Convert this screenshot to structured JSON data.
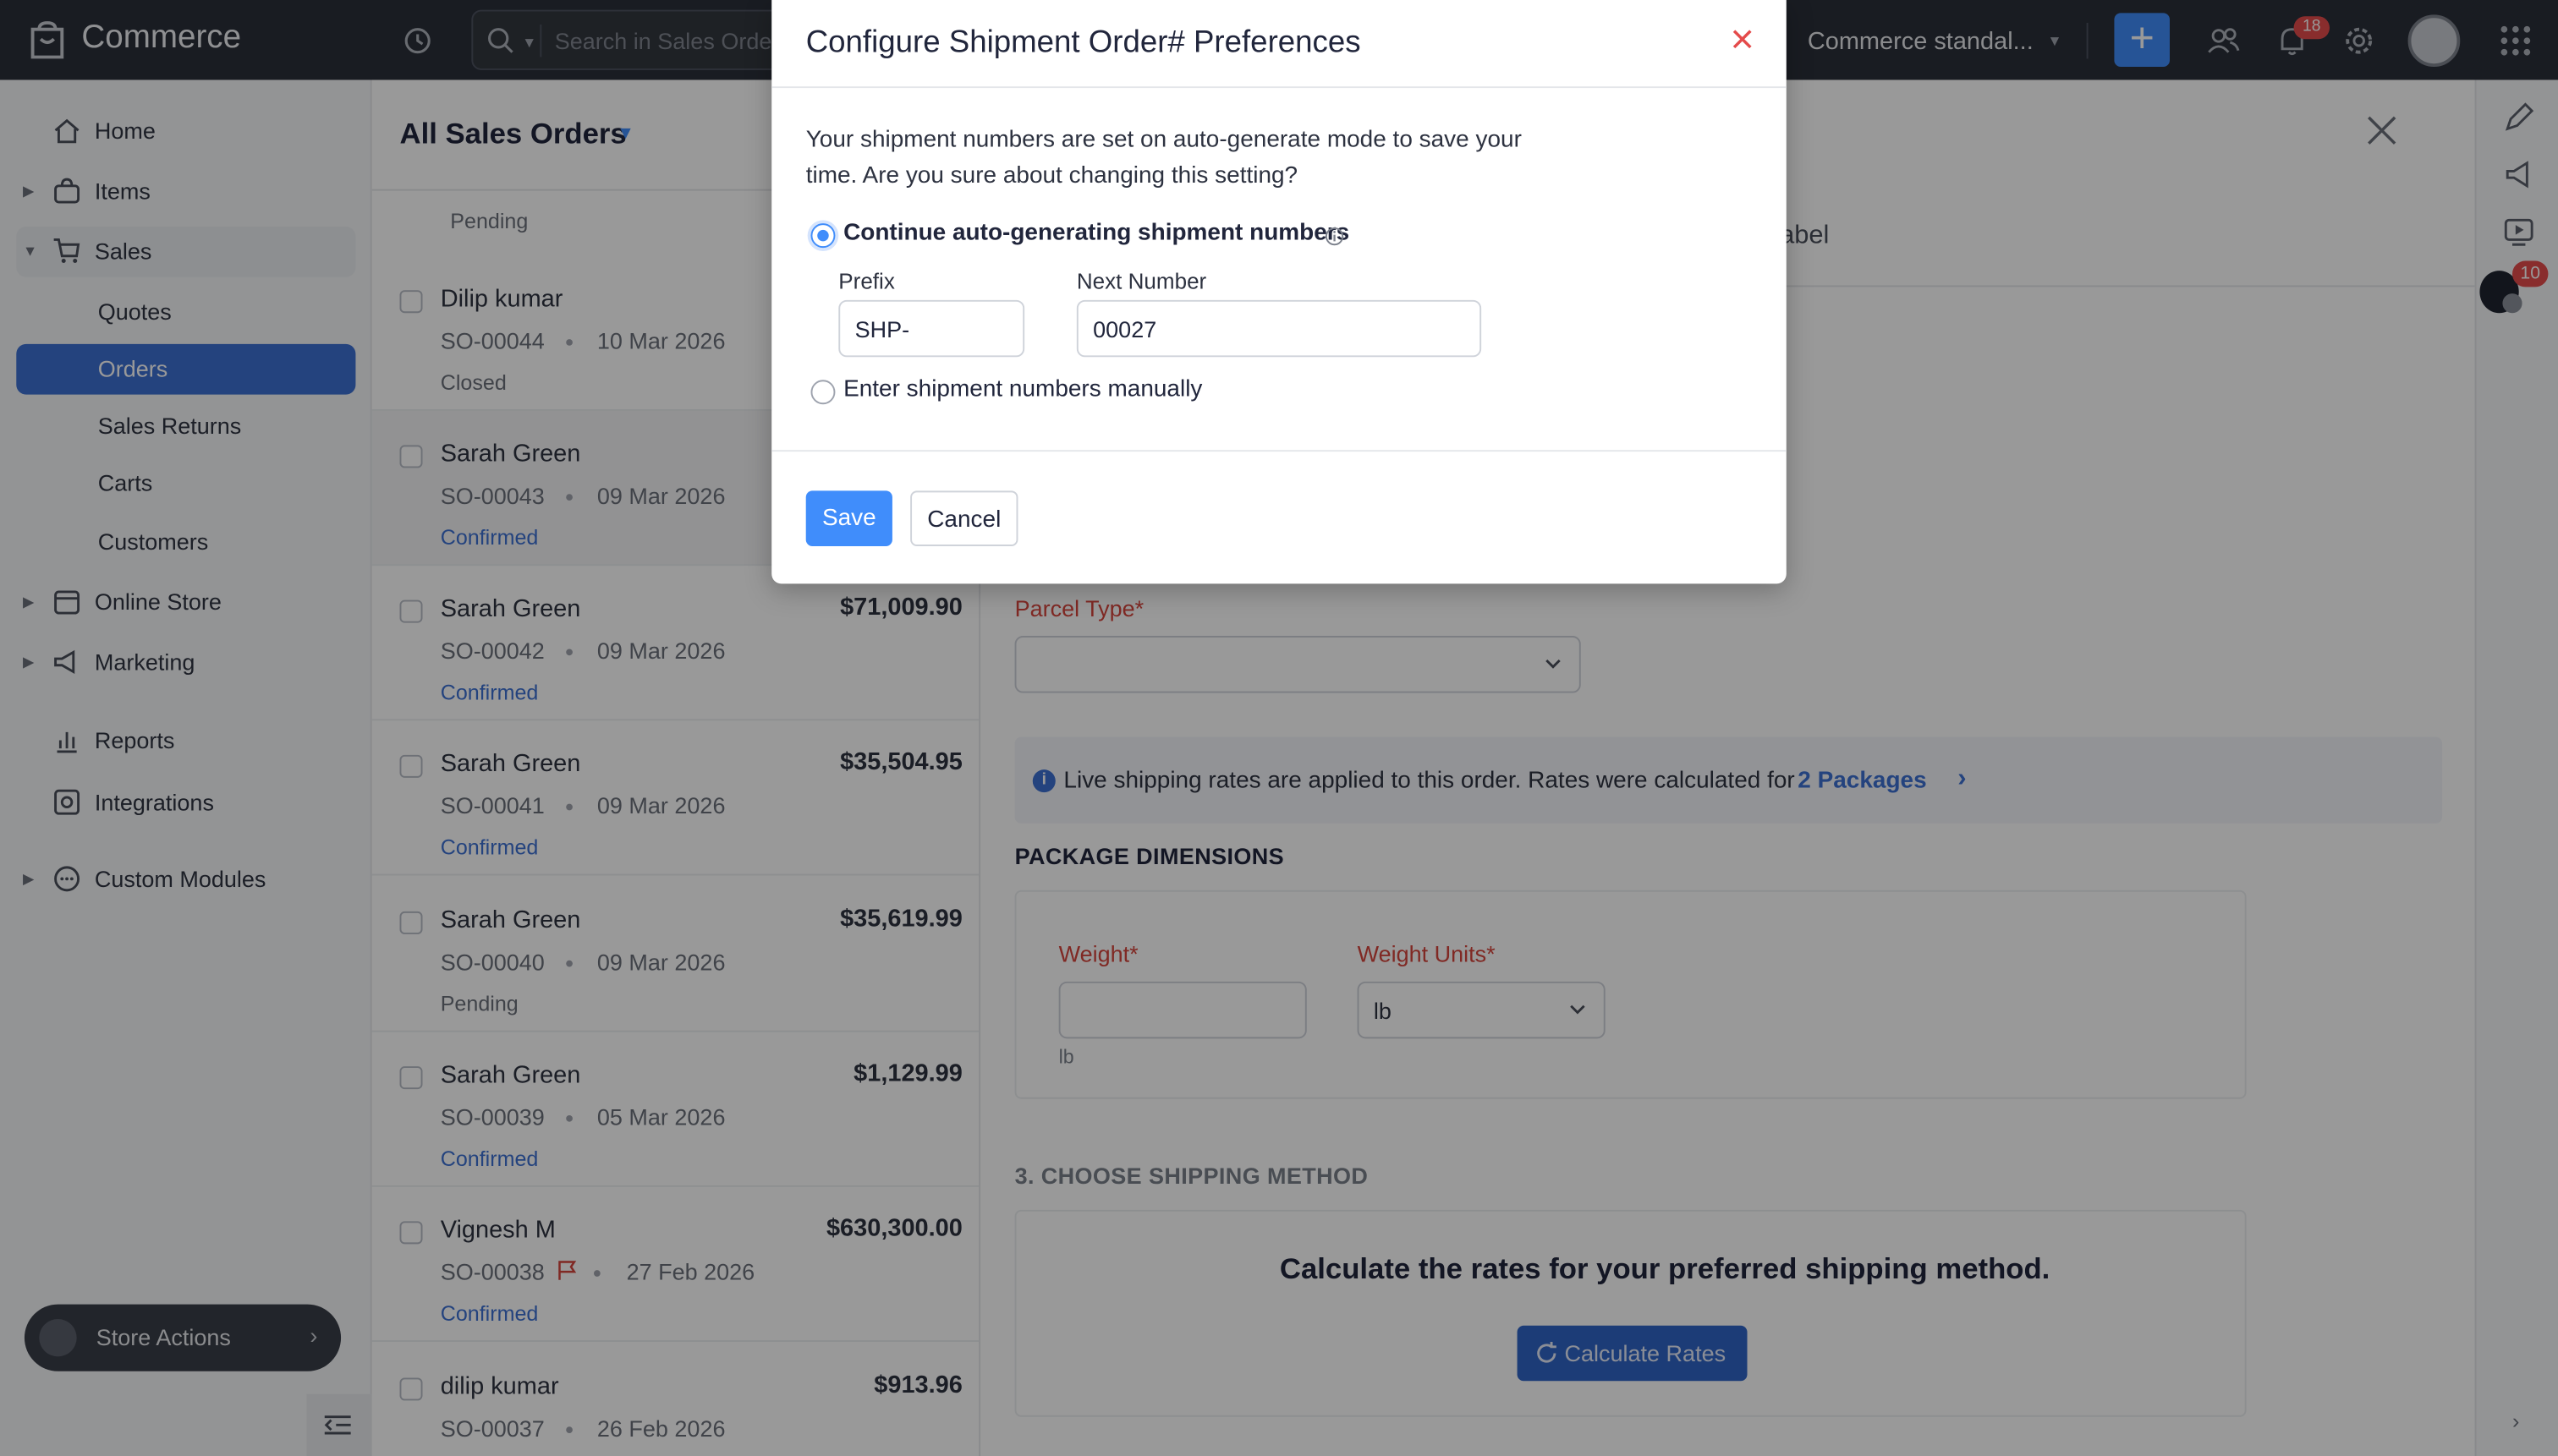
{
  "topbar": {
    "app_name": "Commerce",
    "search_placeholder": "Search in Sales Orders ( / )",
    "org_name": "Commerce standal...",
    "notifications_count": "18"
  },
  "sidebar": {
    "items": [
      {
        "label": "Home"
      },
      {
        "label": "Items"
      },
      {
        "label": "Sales"
      },
      {
        "label": "Quotes"
      },
      {
        "label": "Orders"
      },
      {
        "label": "Sales Returns"
      },
      {
        "label": "Carts"
      },
      {
        "label": "Customers"
      },
      {
        "label": "Online Store"
      },
      {
        "label": "Marketing"
      },
      {
        "label": "Reports"
      },
      {
        "label": "Integrations"
      },
      {
        "label": "Custom Modules"
      }
    ],
    "store_actions": "Store Actions"
  },
  "list": {
    "title": "All Sales Orders",
    "top_partial_status": "Pending",
    "rows": [
      {
        "customer": "Dilip kumar",
        "amount": "",
        "number": "SO-00044",
        "date": "10 Mar 2026",
        "status": "Closed",
        "status_color": "#6b707b"
      },
      {
        "customer": "Sarah Green",
        "amount": "",
        "number": "SO-00043",
        "date": "09 Mar 2026",
        "status": "Confirmed",
        "status_color": "#3c70d3"
      },
      {
        "customer": "Sarah Green",
        "amount": "$71,009.90",
        "number": "SO-00042",
        "date": "09 Mar 2026",
        "status": "Confirmed",
        "status_color": "#3c70d3"
      },
      {
        "customer": "Sarah Green",
        "amount": "$35,504.95",
        "number": "SO-00041",
        "date": "09 Mar 2026",
        "status": "Confirmed",
        "status_color": "#3c70d3"
      },
      {
        "customer": "Sarah Green",
        "amount": "$35,619.99",
        "number": "SO-00040",
        "date": "09 Mar 2026",
        "status": "Pending",
        "status_color": "#6b707b"
      },
      {
        "customer": "Sarah Green",
        "amount": "$1,129.99",
        "number": "SO-00039",
        "date": "05 Mar 2026",
        "status": "Confirmed",
        "status_color": "#3c70d3"
      },
      {
        "customer": "Vignesh M",
        "amount": "$630,300.00",
        "number": "SO-00038",
        "date": "27 Feb 2026",
        "status": "Confirmed",
        "status_color": "#3c70d3"
      },
      {
        "customer": "dilip kumar",
        "amount": "$913.96",
        "number": "SO-00037",
        "date": "26 Feb 2026",
        "status": "",
        "status_color": "#6b707b"
      }
    ]
  },
  "detail": {
    "tab_fragment": "abel",
    "parcel_type_label": "Parcel Type*",
    "rates_info": "Live shipping rates are applied to this order. Rates were calculated for",
    "rates_link": "2 Packages",
    "package_dimensions": "PACKAGE DIMENSIONS",
    "weight_label": "Weight*",
    "weight_units_label": "Weight Units*",
    "weight_units_value": "lb",
    "weight_unit_note": "lb",
    "choose_shipping": "3. CHOOSE SHIPPING METHOD",
    "calc_title": "Calculate the rates for your preferred shipping method.",
    "calc_button": "Calculate Rates"
  },
  "rightrail": {
    "badge": "10"
  },
  "modal": {
    "title": "Configure Shipment Order# Preferences",
    "message": "Your shipment numbers are set on auto-generate mode to save your time. Are you sure about changing this setting?",
    "option_auto": "Continue auto-generating shipment numbers",
    "option_manual": "Enter shipment numbers manually",
    "prefix_label": "Prefix",
    "prefix_value": "SHP-",
    "next_number_label": "Next Number",
    "next_number_value": "00027",
    "save": "Save",
    "cancel": "Cancel"
  },
  "colors": {
    "accent": "#408dfb",
    "topbar": "#2b2f3a",
    "active_nav": "#3c70d3",
    "required_label": "#d6453d",
    "close_red": "#e44b4b"
  }
}
